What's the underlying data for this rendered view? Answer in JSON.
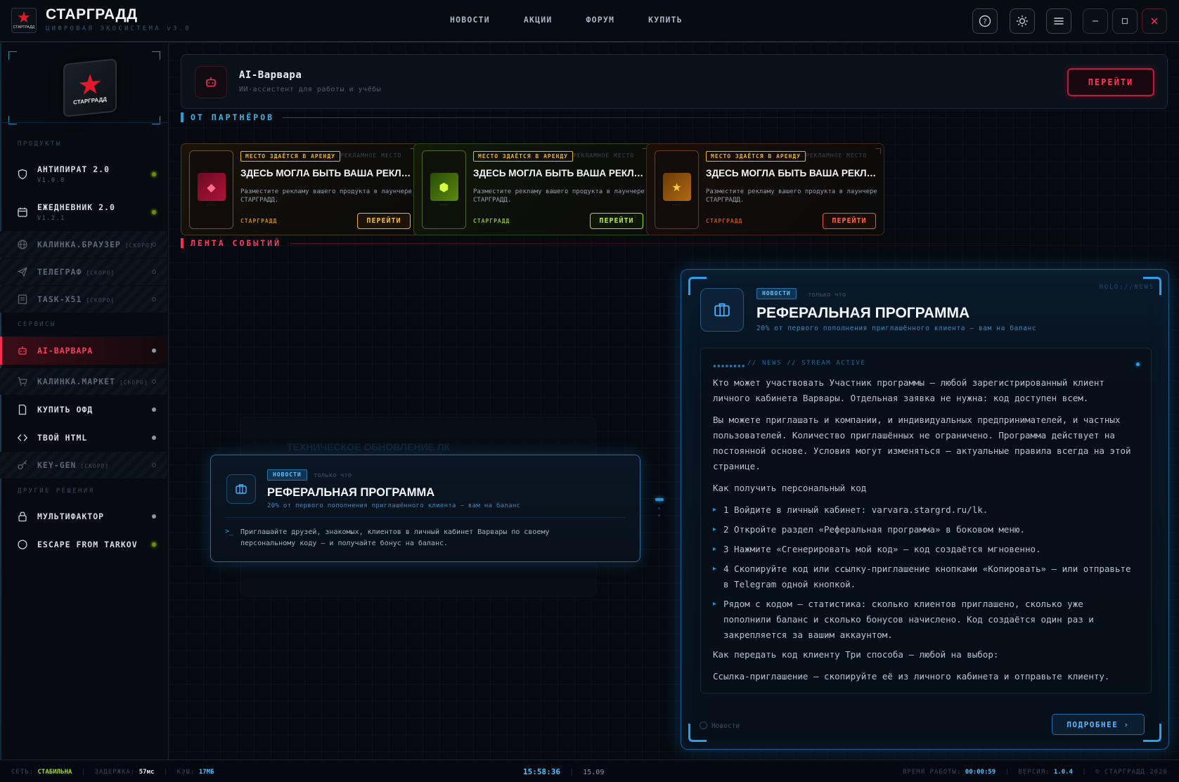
{
  "header": {
    "logo_text": "СТАРГРАДД",
    "title": "СТАРГРАДД",
    "subtitle": "ЦИФРОВАЯ ЭКОСИСТЕМА v3.0",
    "nav": [
      "НОВОСТИ",
      "АКЦИИ",
      "ФОРУМ",
      "КУПИТЬ"
    ],
    "icons": [
      "help-icon",
      "sun-icon",
      "menu-icon",
      "minimize-icon",
      "maximize-icon",
      "close-icon"
    ]
  },
  "sidebar": {
    "hero_label": "СТАРГРАДД",
    "sections": {
      "products": "ПРОДУКТЫ",
      "services": "СЕРВИСЫ",
      "other": "ДРУГИЕ РЕШЕНИЯ"
    },
    "products": [
      {
        "label": "АНТИПИРАТ 2.0",
        "version": "V1.0.8"
      },
      {
        "label": "ЕЖЕДНЕВНИК 2.0",
        "version": "V1.2.1"
      },
      {
        "label": "КАЛИНКА.БРАУЗЕР",
        "soon": "[СКОРО]"
      },
      {
        "label": "ТЕЛЕГРАФ",
        "soon": "[СКОРО]"
      },
      {
        "label": "TASK-X51",
        "soon": "[СКОРО]"
      }
    ],
    "services": [
      {
        "label": "AI-ВАРВАРА"
      },
      {
        "label": "КАЛИНКА.МАРКЕТ",
        "soon": "[СКОРО]"
      },
      {
        "label": "КУПИТЬ ОФД"
      },
      {
        "label": "ТВОЙ HTML"
      },
      {
        "label": "KEY-GEN",
        "soon": "[СКОРО]"
      }
    ],
    "other": [
      {
        "label": "МУЛЬТИФАКТОР"
      },
      {
        "label": "ESCAPE FROM TARKOV"
      }
    ]
  },
  "ai_card": {
    "title": "AI-Варвара",
    "subtitle": "ИИ-ассистент для работы и учёбы",
    "button": "ПЕРЕЙТИ"
  },
  "partners": {
    "title": "ОТ ПАРТНЁРОВ",
    "cards": [
      {
        "badge": "МЕСТО ЗДАЁТСЯ В АРЕНДУ",
        "ad": "РЕКЛАМНОЕ МЕСТО",
        "title": "ЗДЕСЬ МОГЛА БЫТЬ ВАША РЕКЛАМА",
        "desc": "Разместите рекламу вашего продукта в лаунчере СТАРГРАДД.",
        "brand": "СТАРГРАДД",
        "button": "ПЕРЕЙТИ",
        "accent": "#f0b020"
      },
      {
        "badge": "МЕСТО ЗДАЁТСЯ В АРЕНДУ",
        "ad": "РЕКЛАМНОЕ МЕСТО",
        "title": "ЗДЕСЬ МОГЛА БЫТЬ ВАША РЕКЛАМА",
        "desc": "Разместите рекламу вашего продукта в лаунчере СТАРГРАДД.",
        "brand": "СТАРГРАДД",
        "button": "ПЕРЕЙТИ",
        "accent": "#9fe020"
      },
      {
        "badge": "МЕСТО ЗДАЁТСЯ В АРЕНДУ",
        "ad": "РЕКЛАМНОЕ МЕСТО",
        "title": "ЗДЕСЬ МОГЛА БЫТЬ ВАША РЕКЛАМА",
        "desc": "Разместите рекламу вашего продукта в лаунчере СТАРГРАДД.",
        "brand": "СТАРГРАДД",
        "button": "ПЕРЕЙТИ",
        "accent": "#f05a20"
      }
    ]
  },
  "feed": {
    "title": "ЛЕНТА СОБЫТИЙ",
    "ghost_title": "ТЕХНИЧЕСКОЕ ОБНОВЛЕНИЕ ЛК",
    "card": {
      "tag": "НОВОСТИ",
      "time": "только что",
      "title": "РЕФЕРАЛЬНАЯ ПРОГРАММА",
      "subtitle": "20% от первого пополнения приглашённого клиента — вам на баланс",
      "prompt": ">_",
      "body": "Приглашайте друзей, знакомых, клиентов в личный кабинет Варвары по своему персональному коду — и получайте бонус на баланс."
    }
  },
  "holo": {
    "tag_label": "HOLO://NEWS",
    "tag": "НОВОСТИ",
    "time": "только что",
    "title": "РЕФЕРАЛЬНАЯ ПРОГРАММА",
    "subtitle": "20% от первого пополнения приглашённого клиента — вам на баланс",
    "stream_label": "// NEWS // STREAM ACTIVE",
    "paragraphs": [
      "Кто может участвовать Участник программы — любой зарегистрированный клиент личного кабинета Варвары. Отдельная заявка не нужна: код доступен всем.",
      "Вы можете приглашать и компании, и индивидуальных предпринимателей, и частных пользователей. Количество приглашённых не ограничено. Программа действует на постоянной основе. Условия могут изменяться — актуальные правила всегда на этой странице.",
      "Как получить персональный код"
    ],
    "steps": [
      "1 Войдите в личный кабинет: varvara.stargrd.ru/lk.",
      "2 Откройте раздел «Реферальная программа» в боковом меню.",
      "3 Нажмите «Сгенерировать мой код» — код создаётся мгновенно.",
      "4 Скопируйте код или ссылку-приглашение кнопками «Копировать» — или отправьте в Telegram одной кнопкой.",
      "Рядом с кодом — статистика: сколько клиентов приглашено, сколько уже пополнили баланс и сколько бонусов начислено. Код создаётся один раз и закрепляется за вашим аккаунтом."
    ],
    "after": [
      "Как передать код клиенту Три способа — любой на выбор:",
      "Ссылка-приглашение — скопируйте её из личного кабинета и отправьте клиенту."
    ],
    "footer_label": "Новости",
    "more_button": "ПОДРОБНЕЕ ›"
  },
  "status": {
    "net_label": "СЕТЬ:",
    "net_value": "СТАБИЛЬНА",
    "latency_label": "ЗАДЕРЖКА:",
    "latency_value": "57мс",
    "cache_label": "КЭШ:",
    "cache_value": "17МБ",
    "time": "15:58:36",
    "date": "15.09",
    "uptime_label": "ВРЕМЯ РАБОТЫ:",
    "uptime_value": "00:00:59",
    "version_label": "ВЕРСИЯ:",
    "version_value": "1.0.4",
    "copyright": "© СТАРГРАДД 2026"
  }
}
